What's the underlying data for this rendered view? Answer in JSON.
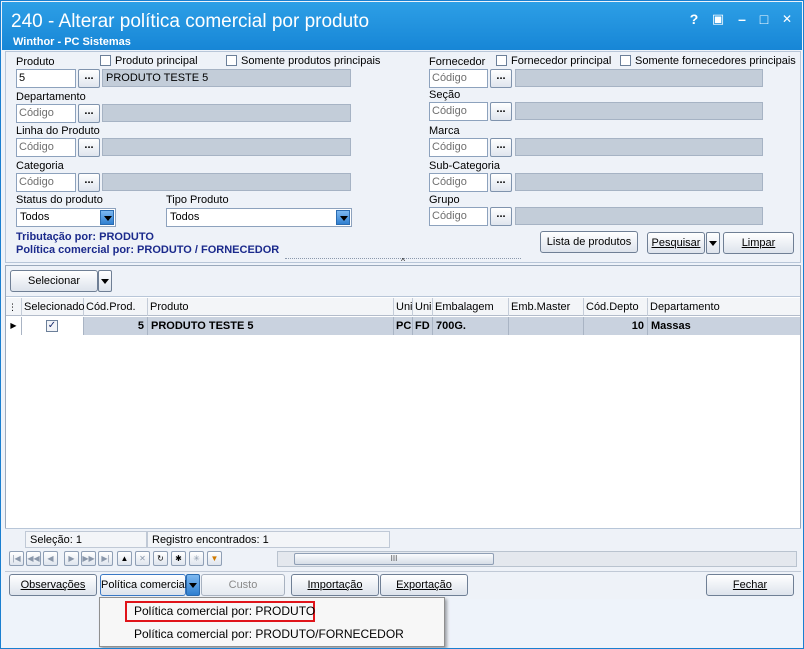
{
  "window": {
    "title": "240 - Alterar política comercial por produto",
    "subtitle": "Winthor - PC Sistemas",
    "controls": {
      "help": "?",
      "restore": "▣",
      "minimize": "–",
      "maximize": "□",
      "close": "✕"
    }
  },
  "filters": {
    "produto": {
      "label": "Produto",
      "value": "5",
      "description": "PRODUTO TESTE 5"
    },
    "produto_principal": {
      "label": "Produto principal",
      "checked": false
    },
    "somente_produtos_principais": {
      "label": "Somente produtos principais",
      "checked": false
    },
    "departamento": {
      "label": "Departamento",
      "placeholder": "Código"
    },
    "linha_produto": {
      "label": "Linha do Produto",
      "placeholder": "Código"
    },
    "categoria": {
      "label": "Categoria",
      "placeholder": "Código"
    },
    "status_produto": {
      "label": "Status do produto",
      "value": "Todos"
    },
    "tipo_produto": {
      "label": "Tipo Produto",
      "value": "Todos"
    },
    "fornecedor": {
      "label": "Fornecedor",
      "placeholder": "Código"
    },
    "fornecedor_principal": {
      "label": "Fornecedor principal",
      "checked": false
    },
    "somente_fornecedores_principais": {
      "label": "Somente fornecedores principais",
      "checked": false
    },
    "secao": {
      "label": "Seção",
      "placeholder": "Código"
    },
    "marca": {
      "label": "Marca",
      "placeholder": "Código"
    },
    "subcategoria": {
      "label": "Sub-Categoria",
      "placeholder": "Código"
    },
    "grupo": {
      "label": "Grupo",
      "placeholder": "Código"
    },
    "browse_label": "..."
  },
  "info": {
    "tributacao": "Tributação por: PRODUTO",
    "politica": "Política comercial por: PRODUTO / FORNECEDOR"
  },
  "actions": {
    "lista_produtos": "Lista de produtos",
    "pesquisar": "Pesquisar",
    "limpar": "Limpar"
  },
  "grid": {
    "selecionar_label": "Selecionar",
    "columns": [
      "Selecionado",
      "Cód.Prod.",
      "Produto",
      "Uni",
      "Uni",
      "Embalagem",
      "Emb.Master",
      "Cód.Depto",
      "Departamento"
    ],
    "rows": [
      {
        "selecionado": true,
        "cod_prod": "5",
        "produto": "PRODUTO TESTE 5",
        "uni1": "PC",
        "uni2": "FD",
        "embalagem": "700G.",
        "emb_master": "",
        "cod_depto": "10",
        "departamento": "Massas"
      }
    ]
  },
  "status": {
    "selecao": "Seleção: 1",
    "registros": "Registro encontrados: 1"
  },
  "scroll": {
    "thumb": "III"
  },
  "footer": {
    "observacoes": "Observações",
    "politica_comercial": "Política comercial",
    "custo": "Custo",
    "importacao": "Importação",
    "exportacao": "Exportação",
    "fechar": "Fechar"
  },
  "dropdown_menu": {
    "items": [
      "Política comercial por: PRODUTO",
      "Política comercial por: PRODUTO/FORNECEDOR"
    ],
    "highlight_color": "#e0141a"
  }
}
